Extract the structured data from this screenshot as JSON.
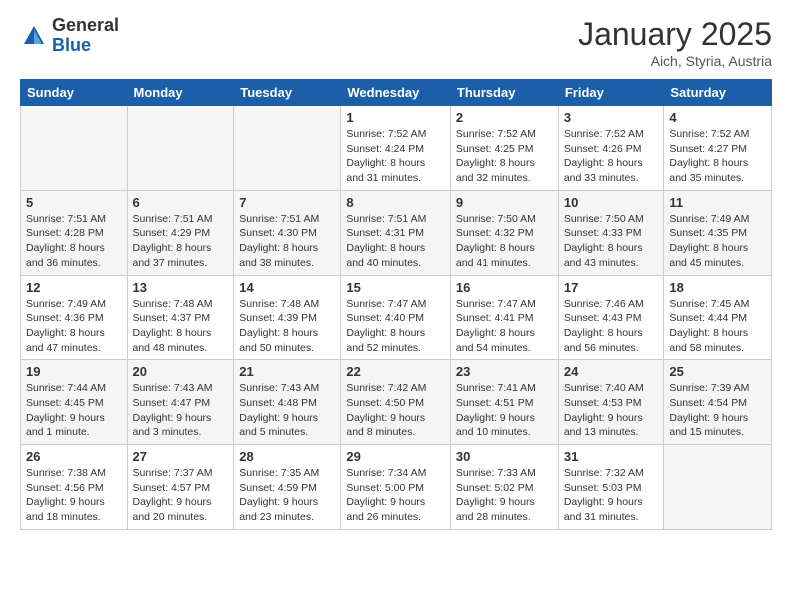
{
  "logo": {
    "general": "General",
    "blue": "Blue"
  },
  "header": {
    "month": "January 2025",
    "location": "Aich, Styria, Austria"
  },
  "days_of_week": [
    "Sunday",
    "Monday",
    "Tuesday",
    "Wednesday",
    "Thursday",
    "Friday",
    "Saturday"
  ],
  "weeks": [
    [
      {
        "day": "",
        "info": ""
      },
      {
        "day": "",
        "info": ""
      },
      {
        "day": "",
        "info": ""
      },
      {
        "day": "1",
        "info": "Sunrise: 7:52 AM\nSunset: 4:24 PM\nDaylight: 8 hours\nand 31 minutes."
      },
      {
        "day": "2",
        "info": "Sunrise: 7:52 AM\nSunset: 4:25 PM\nDaylight: 8 hours\nand 32 minutes."
      },
      {
        "day": "3",
        "info": "Sunrise: 7:52 AM\nSunset: 4:26 PM\nDaylight: 8 hours\nand 33 minutes."
      },
      {
        "day": "4",
        "info": "Sunrise: 7:52 AM\nSunset: 4:27 PM\nDaylight: 8 hours\nand 35 minutes."
      }
    ],
    [
      {
        "day": "5",
        "info": "Sunrise: 7:51 AM\nSunset: 4:28 PM\nDaylight: 8 hours\nand 36 minutes."
      },
      {
        "day": "6",
        "info": "Sunrise: 7:51 AM\nSunset: 4:29 PM\nDaylight: 8 hours\nand 37 minutes."
      },
      {
        "day": "7",
        "info": "Sunrise: 7:51 AM\nSunset: 4:30 PM\nDaylight: 8 hours\nand 38 minutes."
      },
      {
        "day": "8",
        "info": "Sunrise: 7:51 AM\nSunset: 4:31 PM\nDaylight: 8 hours\nand 40 minutes."
      },
      {
        "day": "9",
        "info": "Sunrise: 7:50 AM\nSunset: 4:32 PM\nDaylight: 8 hours\nand 41 minutes."
      },
      {
        "day": "10",
        "info": "Sunrise: 7:50 AM\nSunset: 4:33 PM\nDaylight: 8 hours\nand 43 minutes."
      },
      {
        "day": "11",
        "info": "Sunrise: 7:49 AM\nSunset: 4:35 PM\nDaylight: 8 hours\nand 45 minutes."
      }
    ],
    [
      {
        "day": "12",
        "info": "Sunrise: 7:49 AM\nSunset: 4:36 PM\nDaylight: 8 hours\nand 47 minutes."
      },
      {
        "day": "13",
        "info": "Sunrise: 7:48 AM\nSunset: 4:37 PM\nDaylight: 8 hours\nand 48 minutes."
      },
      {
        "day": "14",
        "info": "Sunrise: 7:48 AM\nSunset: 4:39 PM\nDaylight: 8 hours\nand 50 minutes."
      },
      {
        "day": "15",
        "info": "Sunrise: 7:47 AM\nSunset: 4:40 PM\nDaylight: 8 hours\nand 52 minutes."
      },
      {
        "day": "16",
        "info": "Sunrise: 7:47 AM\nSunset: 4:41 PM\nDaylight: 8 hours\nand 54 minutes."
      },
      {
        "day": "17",
        "info": "Sunrise: 7:46 AM\nSunset: 4:43 PM\nDaylight: 8 hours\nand 56 minutes."
      },
      {
        "day": "18",
        "info": "Sunrise: 7:45 AM\nSunset: 4:44 PM\nDaylight: 8 hours\nand 58 minutes."
      }
    ],
    [
      {
        "day": "19",
        "info": "Sunrise: 7:44 AM\nSunset: 4:45 PM\nDaylight: 9 hours\nand 1 minute."
      },
      {
        "day": "20",
        "info": "Sunrise: 7:43 AM\nSunset: 4:47 PM\nDaylight: 9 hours\nand 3 minutes."
      },
      {
        "day": "21",
        "info": "Sunrise: 7:43 AM\nSunset: 4:48 PM\nDaylight: 9 hours\nand 5 minutes."
      },
      {
        "day": "22",
        "info": "Sunrise: 7:42 AM\nSunset: 4:50 PM\nDaylight: 9 hours\nand 8 minutes."
      },
      {
        "day": "23",
        "info": "Sunrise: 7:41 AM\nSunset: 4:51 PM\nDaylight: 9 hours\nand 10 minutes."
      },
      {
        "day": "24",
        "info": "Sunrise: 7:40 AM\nSunset: 4:53 PM\nDaylight: 9 hours\nand 13 minutes."
      },
      {
        "day": "25",
        "info": "Sunrise: 7:39 AM\nSunset: 4:54 PM\nDaylight: 9 hours\nand 15 minutes."
      }
    ],
    [
      {
        "day": "26",
        "info": "Sunrise: 7:38 AM\nSunset: 4:56 PM\nDaylight: 9 hours\nand 18 minutes."
      },
      {
        "day": "27",
        "info": "Sunrise: 7:37 AM\nSunset: 4:57 PM\nDaylight: 9 hours\nand 20 minutes."
      },
      {
        "day": "28",
        "info": "Sunrise: 7:35 AM\nSunset: 4:59 PM\nDaylight: 9 hours\nand 23 minutes."
      },
      {
        "day": "29",
        "info": "Sunrise: 7:34 AM\nSunset: 5:00 PM\nDaylight: 9 hours\nand 26 minutes."
      },
      {
        "day": "30",
        "info": "Sunrise: 7:33 AM\nSunset: 5:02 PM\nDaylight: 9 hours\nand 28 minutes."
      },
      {
        "day": "31",
        "info": "Sunrise: 7:32 AM\nSunset: 5:03 PM\nDaylight: 9 hours\nand 31 minutes."
      },
      {
        "day": "",
        "info": ""
      }
    ]
  ]
}
